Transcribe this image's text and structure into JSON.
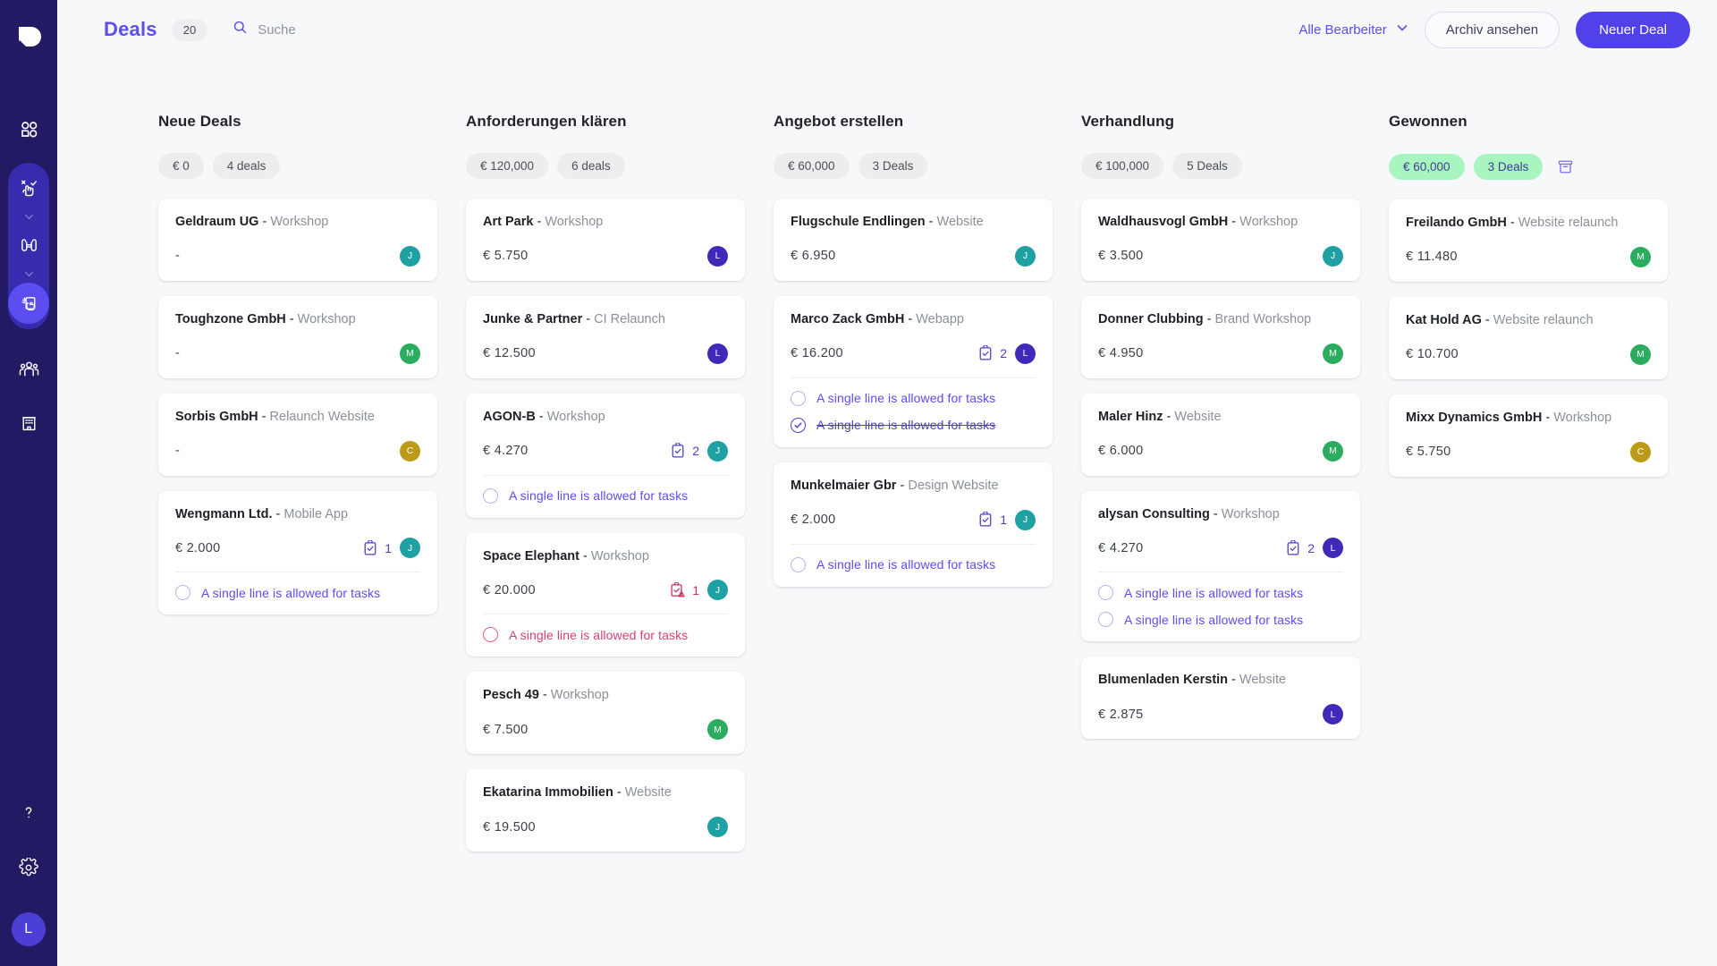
{
  "brand": {
    "logo_name": "deal-logo",
    "sidebar_bg": "#221b64",
    "accent": "#5b4df0"
  },
  "sidebar": {
    "nav": [
      {
        "icon": "dashboard-grid-icon",
        "name": "dashboard",
        "active": false
      },
      {
        "icon": "hand-select-icon",
        "name": "leads",
        "active": false
      },
      {
        "icon": "binoculars-icon",
        "name": "prospecting",
        "active": false
      },
      {
        "icon": "hand-deal-icon",
        "name": "deals",
        "active": true
      },
      {
        "icon": "people-icon",
        "name": "contacts",
        "active": false
      },
      {
        "icon": "building-icon",
        "name": "companies",
        "active": false
      }
    ],
    "bottom": [
      {
        "icon": "help-question-icon",
        "name": "help"
      },
      {
        "icon": "gear-icon",
        "name": "settings"
      }
    ],
    "user_avatar": {
      "initial": "L",
      "color": "#4c3fd6"
    }
  },
  "topbar": {
    "title": "Deals",
    "count": "20",
    "search": {
      "placeholder": "Suche",
      "value": "",
      "icon": "search-icon"
    },
    "filter_label": "Alle Bearbeiter",
    "filter_icon": "chevron-down-icon",
    "archive_label": "Archiv ansehen",
    "new_deal_label": "Neuer Deal"
  },
  "task_placeholder": "A single line is allowed for tasks",
  "avatar_colors": {
    "J": "#1fa0a3",
    "L": "#4228b8",
    "M": "#2bac5f",
    "C": "#bb9a17"
  },
  "columns": [
    {
      "title": "Neue Deals",
      "amount_badge": "€ 0",
      "deals_badge": "4 deals",
      "highlight": false,
      "archive_icon": null,
      "cards": [
        {
          "company": "Geldraum UG",
          "type": "Workshop",
          "amount": "-",
          "tasks_count": null,
          "avatar": "J",
          "tasks": []
        },
        {
          "company": "Toughzone GmbH",
          "type": "Workshop",
          "amount": "-",
          "tasks_count": null,
          "avatar": "M",
          "tasks": []
        },
        {
          "company": "Sorbis GmbH",
          "type": "Relaunch Website",
          "amount": "-",
          "tasks_count": null,
          "avatar": "C",
          "tasks": []
        },
        {
          "company": "Wengmann Ltd.",
          "type": "Mobile App",
          "amount": "€ 2.000",
          "tasks_count": "1",
          "task_state": "normal",
          "avatar": "J",
          "tasks": [
            {
              "text": "A single line is allowed for tasks",
              "state": "open"
            }
          ]
        }
      ]
    },
    {
      "title": "Anforderungen klären",
      "amount_badge": "€ 120,000",
      "deals_badge": "6 deals",
      "highlight": false,
      "archive_icon": null,
      "cards": [
        {
          "company": "Art Park",
          "type": "Workshop",
          "amount": "€ 5.750",
          "tasks_count": null,
          "avatar": "L",
          "tasks": []
        },
        {
          "company": "Junke & Partner",
          "type": "CI Relaunch",
          "amount": "€ 12.500",
          "tasks_count": null,
          "avatar": "L",
          "tasks": []
        },
        {
          "company": "AGON-B",
          "type": "Workshop",
          "amount": "€ 4.270",
          "tasks_count": "2",
          "task_state": "normal",
          "avatar": "J",
          "tasks": [
            {
              "text": "A single line is allowed for tasks",
              "state": "open"
            }
          ]
        },
        {
          "company": "Space Elephant",
          "type": "Workshop",
          "amount": "€ 20.000",
          "tasks_count": "1",
          "task_state": "danger",
          "avatar": "J",
          "tasks": [
            {
              "text": "A single line is allowed for tasks",
              "state": "danger"
            }
          ]
        },
        {
          "company": "Pesch 49",
          "type": "Workshop",
          "amount": "€ 7.500",
          "tasks_count": null,
          "avatar": "M",
          "tasks": []
        },
        {
          "company": "Ekatarina Immobilien",
          "type": "Website",
          "amount": "€ 19.500",
          "tasks_count": null,
          "avatar": "J",
          "tasks": []
        }
      ]
    },
    {
      "title": "Angebot erstellen",
      "amount_badge": "€ 60,000",
      "deals_badge": "3 Deals",
      "highlight": false,
      "archive_icon": null,
      "cards": [
        {
          "company": "Flugschule Endlingen",
          "type": "Website",
          "amount": "€ 6.950",
          "tasks_count": null,
          "avatar": "J",
          "tasks": []
        },
        {
          "company": "Marco Zack GmbH",
          "type": "Webapp",
          "amount": "€ 16.200",
          "tasks_count": "2",
          "task_state": "normal",
          "avatar": "L",
          "tasks": [
            {
              "text": "A single line is allowed for tasks",
              "state": "open"
            },
            {
              "text": "A single line is allowed for tasks",
              "state": "done"
            }
          ]
        },
        {
          "company": "Munkelmaier Gbr",
          "type": "Design Website",
          "amount": "€ 2.000",
          "tasks_count": "1",
          "task_state": "normal",
          "avatar": "J",
          "tasks": [
            {
              "text": "A single line is allowed for tasks",
              "state": "open"
            }
          ]
        }
      ]
    },
    {
      "title": "Verhandlung",
      "amount_badge": "€ 100,000",
      "deals_badge": "5 Deals",
      "highlight": false,
      "archive_icon": null,
      "cards": [
        {
          "company": "Waldhausvogl GmbH",
          "type": "Workshop",
          "amount": "€ 3.500",
          "tasks_count": null,
          "avatar": "J",
          "tasks": []
        },
        {
          "company": "Donner Clubbing",
          "type": "Brand Workshop",
          "amount": "€ 4.950",
          "tasks_count": null,
          "avatar": "M",
          "tasks": []
        },
        {
          "company": "Maler Hinz",
          "type": "Website",
          "amount": "€ 6.000",
          "tasks_count": null,
          "avatar": "M",
          "tasks": []
        },
        {
          "company": "alysan Consulting",
          "type": "Workshop",
          "amount": "€ 4.270",
          "tasks_count": "2",
          "task_state": "normal",
          "avatar": "L",
          "tasks": [
            {
              "text": "A single line is allowed for tasks",
              "state": "open"
            },
            {
              "text": "A single line is allowed for tasks",
              "state": "open"
            }
          ]
        },
        {
          "company": "Blumenladen Kerstin",
          "type": "Website",
          "amount": "€ 2.875",
          "tasks_count": null,
          "avatar": "L",
          "tasks": []
        }
      ]
    },
    {
      "title": "Gewonnen",
      "amount_badge": "€ 60,000",
      "deals_badge": "3 Deals",
      "highlight": true,
      "archive_icon": "archive-box-icon",
      "cards": [
        {
          "company": "Freilando GmbH",
          "type": "Website relaunch",
          "amount": "€ 11.480",
          "tasks_count": null,
          "avatar": "M",
          "tasks": []
        },
        {
          "company": "Kat Hold AG",
          "type": "Website relaunch",
          "amount": "€ 10.700",
          "tasks_count": null,
          "avatar": "M",
          "tasks": []
        },
        {
          "company": "Mixx Dynamics GmbH",
          "type": "Workshop",
          "amount": "€ 5.750",
          "tasks_count": null,
          "avatar": "C",
          "tasks": []
        }
      ]
    }
  ]
}
